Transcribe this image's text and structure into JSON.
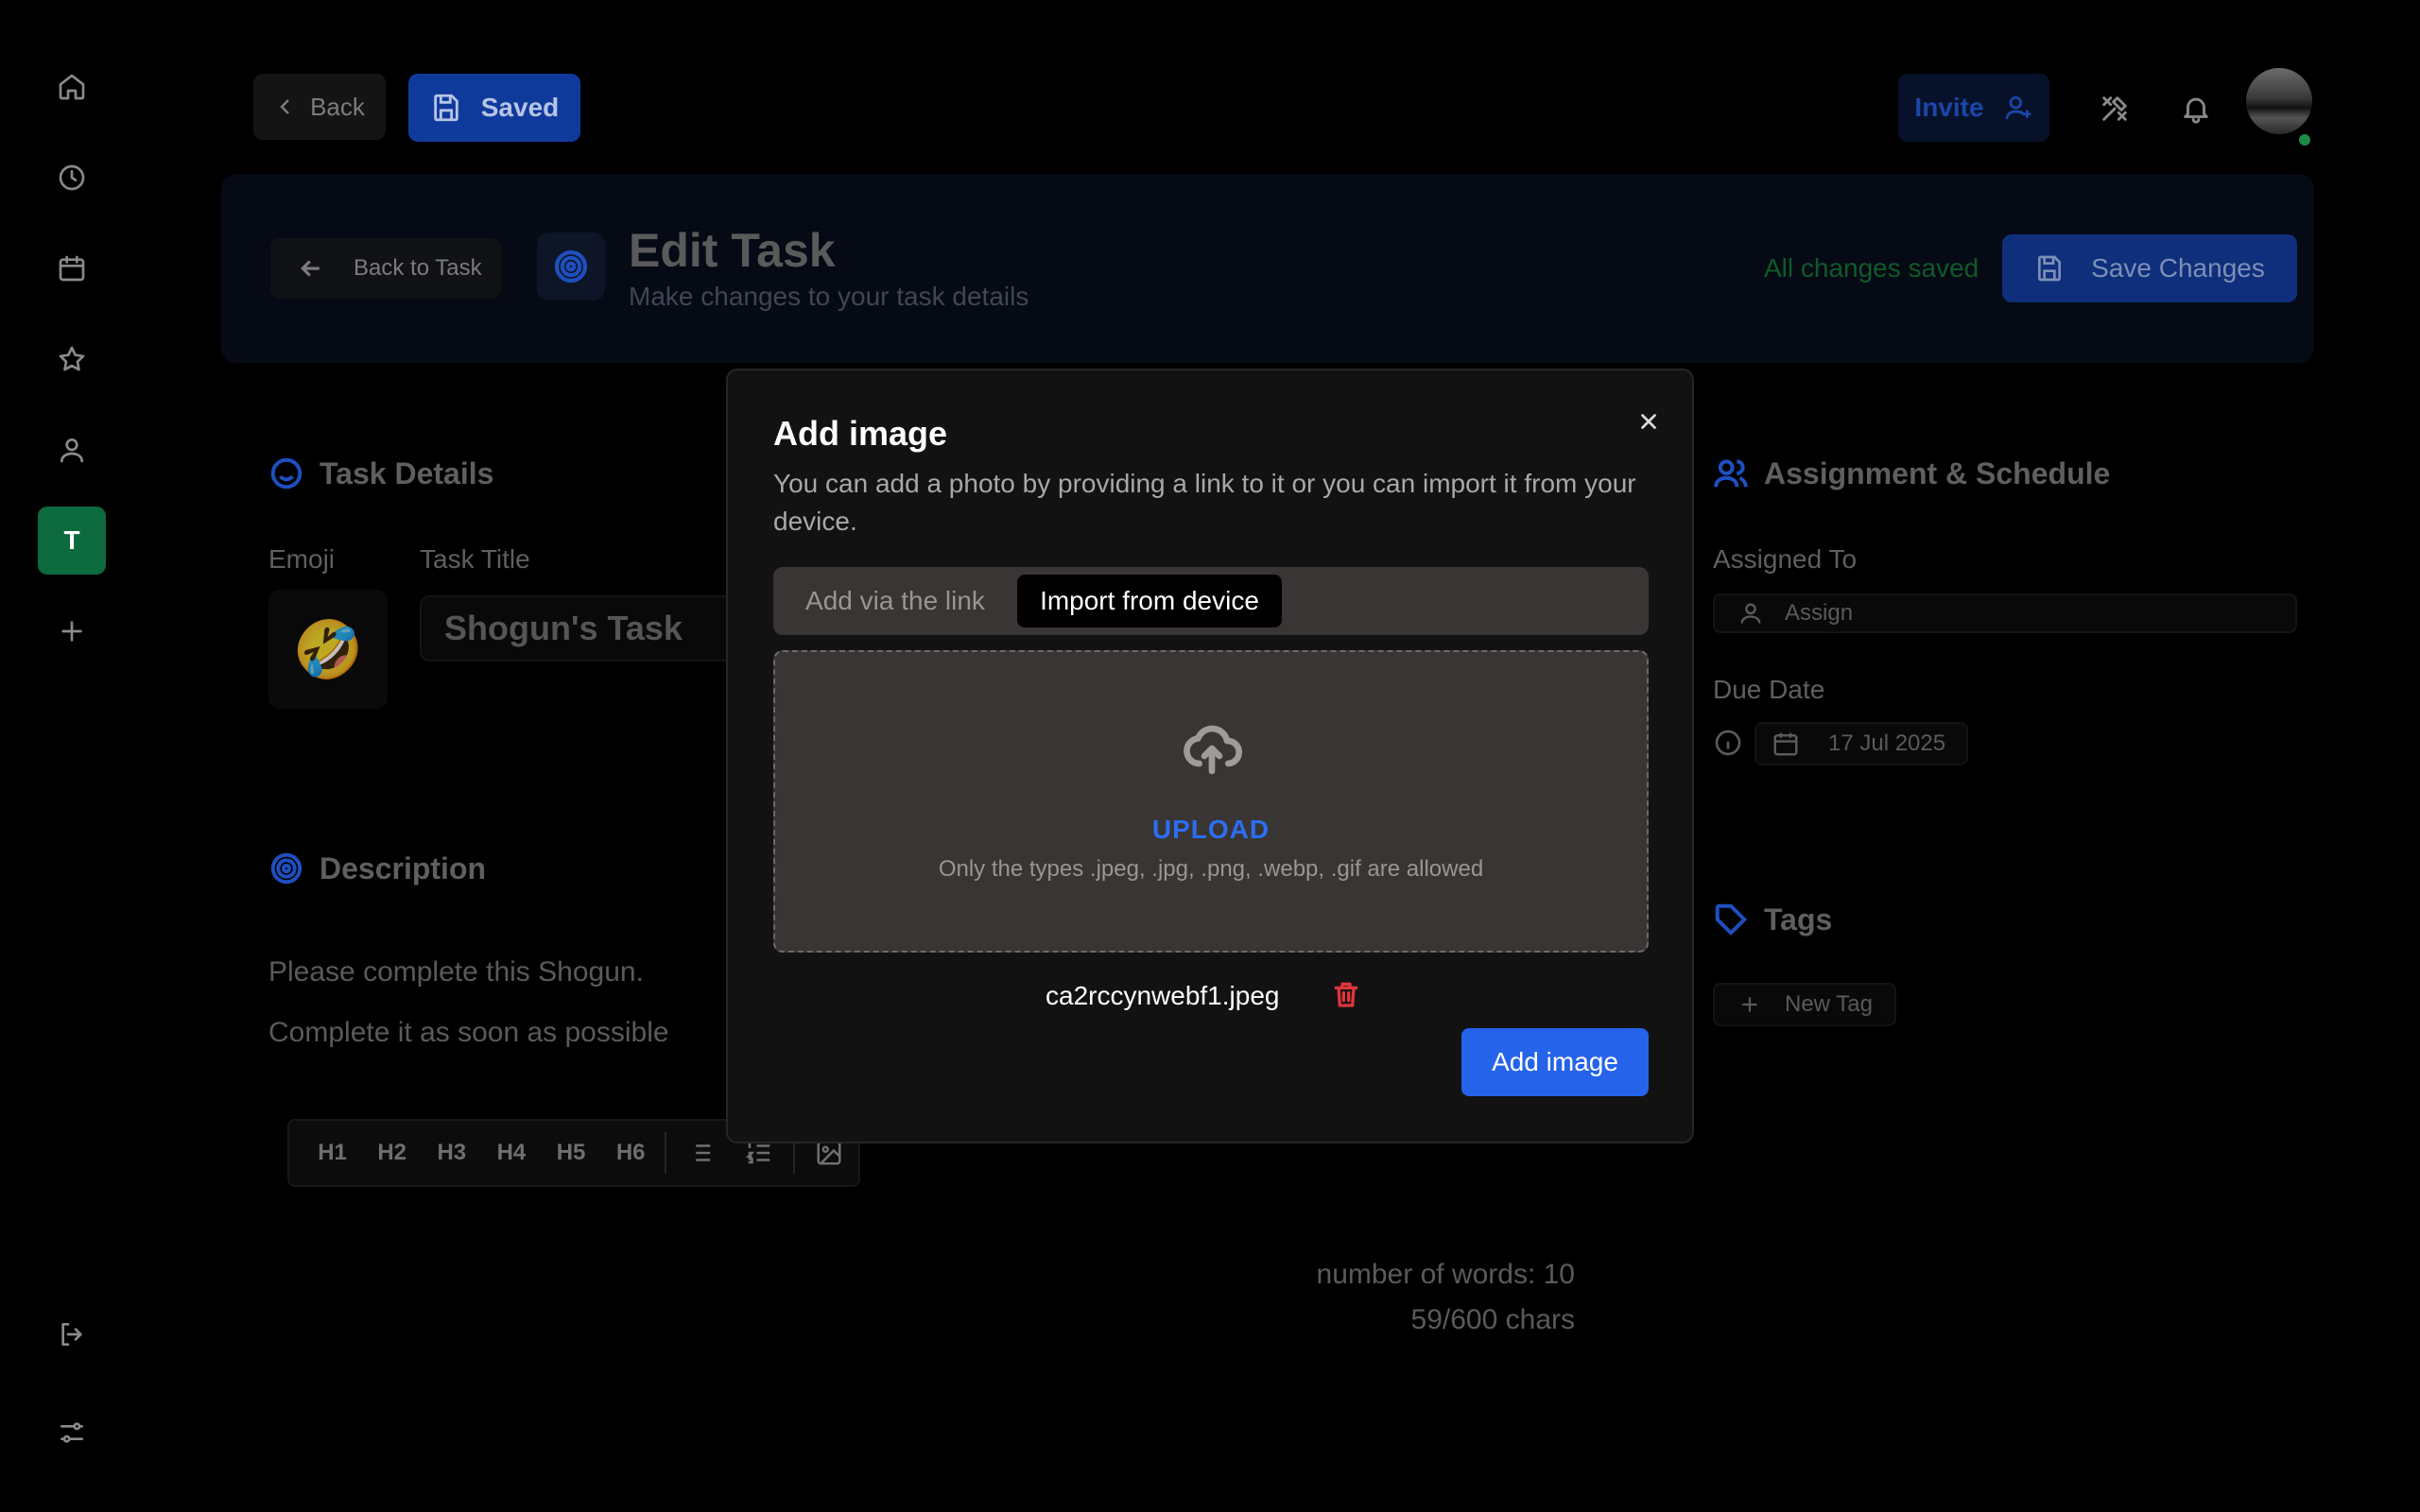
{
  "sidebar": {
    "items": [
      {
        "name": "home",
        "icon": "home-icon"
      },
      {
        "name": "history",
        "icon": "clock-icon"
      },
      {
        "name": "calendar",
        "icon": "calendar-icon"
      },
      {
        "name": "favorites",
        "icon": "star-icon"
      },
      {
        "name": "profile",
        "icon": "user-icon"
      }
    ],
    "workspace_initial": "T",
    "add_icon": "plus-icon",
    "logout_icon": "logout-icon",
    "settings_icon": "sliders-icon"
  },
  "topbar": {
    "back_label": "Back",
    "saved_label": "Saved",
    "invite_label": "Invite",
    "tools_icon": "tools-icon",
    "bell_icon": "bell-icon",
    "status_color": "#1e8a45"
  },
  "header": {
    "back_to_task_label": "Back to Task",
    "title": "Edit Task",
    "subtitle": "Make changes to your task details",
    "save_status": "All changes saved",
    "save_changes_label": "Save Changes"
  },
  "task_details": {
    "section_title": "Task Details",
    "emoji_label": "Emoji",
    "emoji": "🤣",
    "task_title_label": "Task Title",
    "task_title_value": "Shogun's Task"
  },
  "description": {
    "section_title": "Description",
    "lines": [
      "Please complete this Shogun.",
      "Complete it as soon as possible"
    ],
    "toolbar": [
      "H1",
      "H2",
      "H3",
      "H4",
      "H5",
      "H6"
    ],
    "word_count": "number of words: 10",
    "char_count": "59/600 chars"
  },
  "assignment": {
    "section_title": "Assignment & Schedule",
    "assigned_to_label": "Assigned To",
    "assign_placeholder": "Assign",
    "due_date_label": "Due Date",
    "due_date_value": "17 Jul 2025"
  },
  "tags": {
    "section_title": "Tags",
    "new_tag_label": "New Tag"
  },
  "modal": {
    "title": "Add image",
    "description": "You can add a photo by providing a link to it or you can import it from your device.",
    "tab_link": "Add via the link",
    "tab_device": "Import from device",
    "active_tab": "Import from device",
    "upload_label": "UPLOAD",
    "upload_types": "Only the types .jpeg, .jpg, .png, .webp, .gif are allowed",
    "file_name": "ca2rccynwebf1.jpeg",
    "add_button": "Add image",
    "accent_color": "#2563eb",
    "delete_color": "#e0343c"
  }
}
